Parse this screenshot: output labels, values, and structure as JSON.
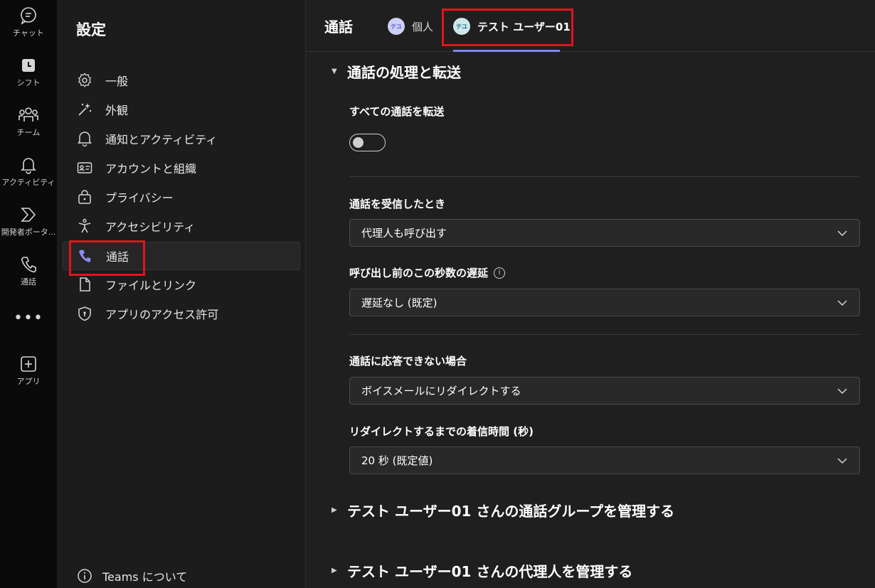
{
  "rail": {
    "items": [
      {
        "label": "チャット",
        "icon": "chat-icon"
      },
      {
        "label": "シフト",
        "icon": "shifts-icon"
      },
      {
        "label": "チーム",
        "icon": "teams-icon"
      },
      {
        "label": "アクティビティ",
        "icon": "bell-icon"
      },
      {
        "label": "開発者ポータ...",
        "icon": "developer-portal-icon"
      },
      {
        "label": "通話",
        "icon": "phone-icon"
      },
      {
        "label": "アプリ",
        "icon": "add-app-icon"
      }
    ],
    "more": "•••"
  },
  "settings": {
    "title": "設定",
    "nav": [
      {
        "label": "一般",
        "icon": "gear-icon"
      },
      {
        "label": "外観",
        "icon": "magic-wand-icon"
      },
      {
        "label": "通知とアクティビティ",
        "icon": "bell-icon"
      },
      {
        "label": "アカウントと組織",
        "icon": "id-card-icon"
      },
      {
        "label": "プライバシー",
        "icon": "lock-icon"
      },
      {
        "label": "アクセシビリティ",
        "icon": "accessibility-icon"
      },
      {
        "label": "通話",
        "icon": "phone-icon",
        "active": true
      },
      {
        "label": "ファイルとリンク",
        "icon": "file-icon"
      },
      {
        "label": "アプリのアクセス許可",
        "icon": "shield-icon"
      }
    ],
    "about": "Teams について"
  },
  "main": {
    "title": "通話",
    "tabs": [
      {
        "label": "個人",
        "avatar": "テユ"
      },
      {
        "label": "テスト ユーザー01",
        "avatar": "テユ",
        "selected": true
      }
    ],
    "section_forwarding": {
      "title": "通話の処理と転送",
      "forward_all_label": "すべての通話を転送",
      "forward_all_on": false,
      "on_receive_label": "通話を受信したとき",
      "on_receive_value": "代理人も呼び出す",
      "delay_label": "呼び出し前のこの秒数の遅延",
      "delay_value": "遅延なし (既定)",
      "unanswered_label": "通話に応答できない場合",
      "unanswered_value": "ボイスメールにリダイレクトする",
      "ring_time_label": "リダイレクトするまでの着信時間 (秒)",
      "ring_time_value": "20 秒 (既定値)"
    },
    "section_call_group": {
      "title": "テスト ユーザー01 さんの通話グループを管理する"
    },
    "section_delegates": {
      "title": "テスト ユーザー01 さんの代理人を管理する"
    }
  },
  "colors": {
    "accent": "#7f85f5",
    "highlight_box": "#e0141e"
  }
}
